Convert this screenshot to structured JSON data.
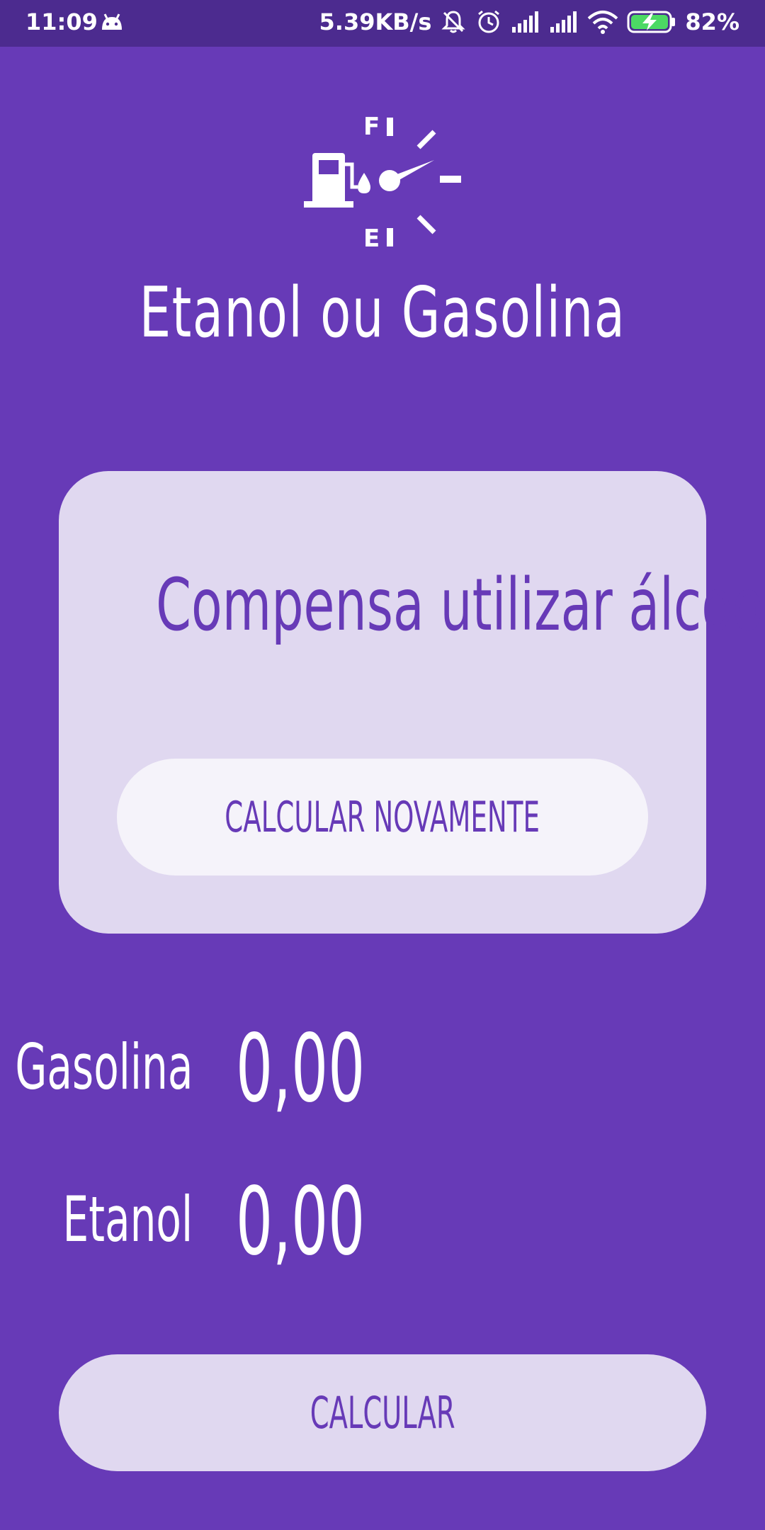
{
  "status_bar": {
    "time": "11:09",
    "network_speed": "5.39KB/s",
    "battery_percent": "82%",
    "icons": [
      "android-icon",
      "mute-bell-icon",
      "alarm-icon",
      "signal-icon",
      "signal-icon",
      "wifi-icon",
      "battery-charging-icon"
    ]
  },
  "header": {
    "logo_icon": "fuel-gauge-icon",
    "gauge_full_label": "F",
    "gauge_empty_label": "E",
    "title": "Etanol ou Gasolina"
  },
  "result_card": {
    "result_text": "Compensa utilizar álcool",
    "recalculate_label": "CALCULAR NOVAMENTE"
  },
  "fields": {
    "gasoline_label": "Gasolina",
    "gasoline_value": "0,00",
    "ethanol_label": "Etanol",
    "ethanol_value": "0,00"
  },
  "actions": {
    "calculate_label": "CALCULAR"
  },
  "colors": {
    "background": "#673ab7",
    "status_bar": "#4c2b8f",
    "card": "#e0d8f0",
    "button_light": "#f5f3fa",
    "accent_text": "#673ab7",
    "battery_green": "#4cd964"
  }
}
